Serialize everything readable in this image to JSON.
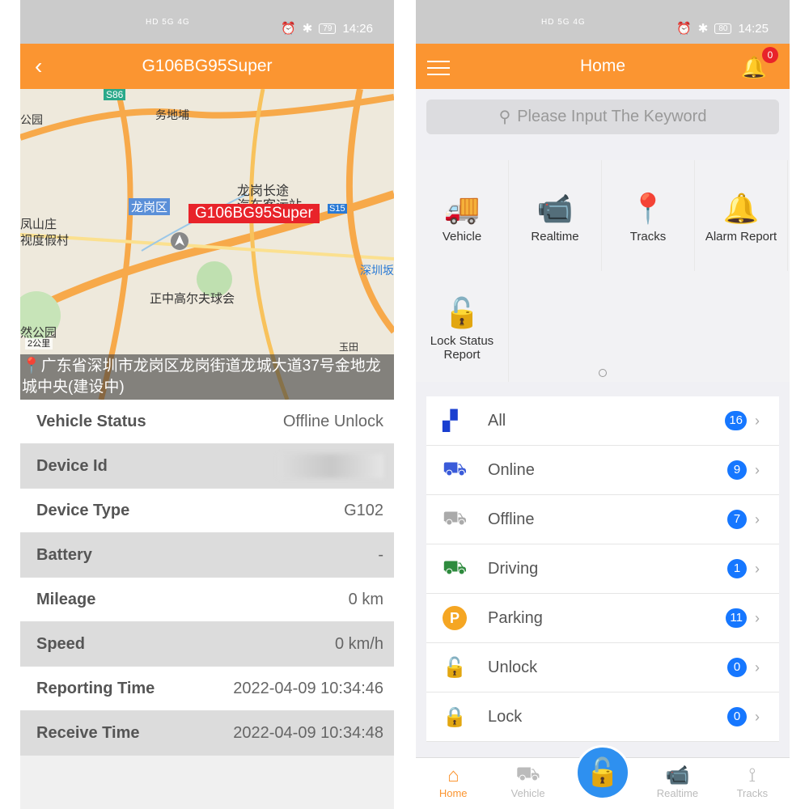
{
  "left": {
    "status": {
      "time": "14:26",
      "battery": "79",
      "signal": "HD 5G 4G"
    },
    "title": "G106BG95Super",
    "map": {
      "marker": "G106BG95Super",
      "labels": [
        "S86",
        "务地埔",
        "公园",
        "龙岗长途",
        "汽车客运站",
        "龙岗区",
        "S15",
        "凤山庄",
        "视度假村",
        "深圳坂",
        "正中高尔夫球会",
        "然公园",
        "2公里",
        "玉田"
      ],
      "address": "广东省深圳市龙岗区龙岗街道龙城大道37号金地龙城中央(建设中)"
    },
    "rows": [
      {
        "key": "Vehicle Status",
        "value": "Offline Unlock"
      },
      {
        "key": "Device Id",
        "value": ""
      },
      {
        "key": "Device Type",
        "value": "G102"
      },
      {
        "key": "Battery",
        "value": "-"
      },
      {
        "key": "Mileage",
        "value": "0 km"
      },
      {
        "key": "Speed",
        "value": "0 km/h"
      },
      {
        "key": "Reporting Time",
        "value": "2022-04-09 10:34:46"
      },
      {
        "key": "Receive Time",
        "value": "2022-04-09 10:34:48"
      }
    ]
  },
  "right": {
    "status": {
      "time": "14:25",
      "battery": "80",
      "signal": "HD 5G 4G"
    },
    "title": "Home",
    "notification_count": "0",
    "search_placeholder": "Please Input The Keyword",
    "grid": [
      {
        "label": "Vehicle",
        "icon": "truck-icon",
        "color": "#fb9531"
      },
      {
        "label": "Realtime",
        "icon": "camera-icon",
        "color": "#3a5bd9"
      },
      {
        "label": "Tracks",
        "icon": "route-icon",
        "color": "#fb9531"
      },
      {
        "label": "Alarm Report",
        "icon": "bell-icon",
        "color": "#e8232a"
      },
      {
        "label": "Lock Status Report",
        "icon": "unlock-icon",
        "color": "#3a6fe0"
      }
    ],
    "list": [
      {
        "label": "All",
        "count": "16",
        "icon": "grid-icon",
        "color": "#1a3fd0"
      },
      {
        "label": "Online",
        "count": "9",
        "icon": "truck-icon",
        "color": "#3a5bd9"
      },
      {
        "label": "Offline",
        "count": "7",
        "icon": "truck-icon",
        "color": "#aaaaaa"
      },
      {
        "label": "Driving",
        "count": "1",
        "icon": "truck-icon",
        "color": "#2e8b3e"
      },
      {
        "label": "Parking",
        "count": "11",
        "icon": "parking-icon",
        "color": "#f5a623"
      },
      {
        "label": "Unlock",
        "count": "0",
        "icon": "unlock-icon",
        "color": "#3a5bd9"
      },
      {
        "label": "Lock",
        "count": "0",
        "icon": "lock-icon",
        "color": "#2e8b3e"
      }
    ],
    "tabs": [
      {
        "label": "Home",
        "active": true
      },
      {
        "label": "Vehicle"
      },
      {
        "label": "Realtime"
      },
      {
        "label": "Tracks"
      }
    ]
  }
}
